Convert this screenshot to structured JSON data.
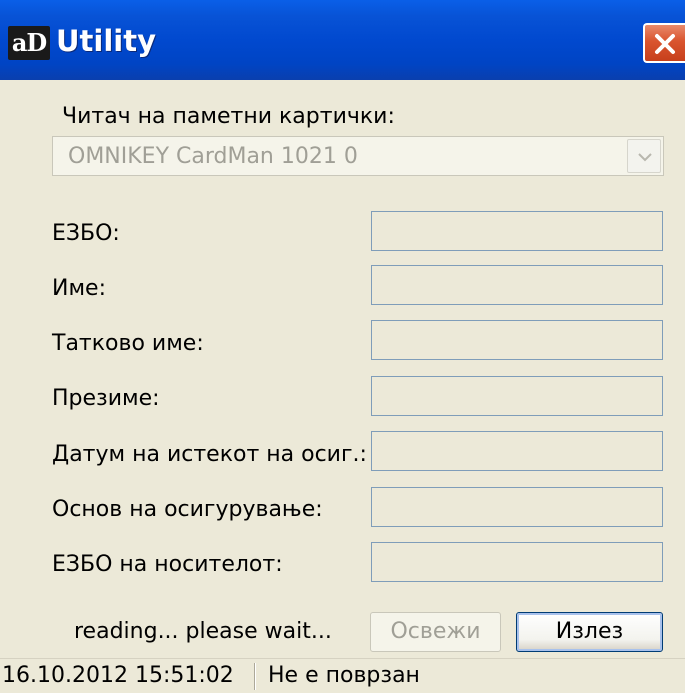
{
  "window": {
    "title": "Utility",
    "logo_text": "aD",
    "title_bar_color": "#0149cf",
    "close_button_color": "#d9542e",
    "background_color": "#ece9d8"
  },
  "reader": {
    "label": "Читач на паметни картички:",
    "selected_value": "OMNIKEY CardMan 1021 0"
  },
  "fields": [
    {
      "label": "ЕЗБО:",
      "value": ""
    },
    {
      "label": "Име:",
      "value": ""
    },
    {
      "label": "Татково име:",
      "value": ""
    },
    {
      "label": "Презиме:",
      "value": ""
    },
    {
      "label": "Датум на истекот на осиг.:",
      "value": ""
    },
    {
      "label": "Основ на осигурување:",
      "value": ""
    },
    {
      "label": "ЕЗБО на носителот:",
      "value": ""
    }
  ],
  "status_message": "reading... please wait...",
  "buttons": {
    "refresh": "Освежи",
    "exit": "Излез"
  },
  "statusbar": {
    "datetime": "16.10.2012 15:51:02",
    "connection": "Не е поврзан"
  }
}
